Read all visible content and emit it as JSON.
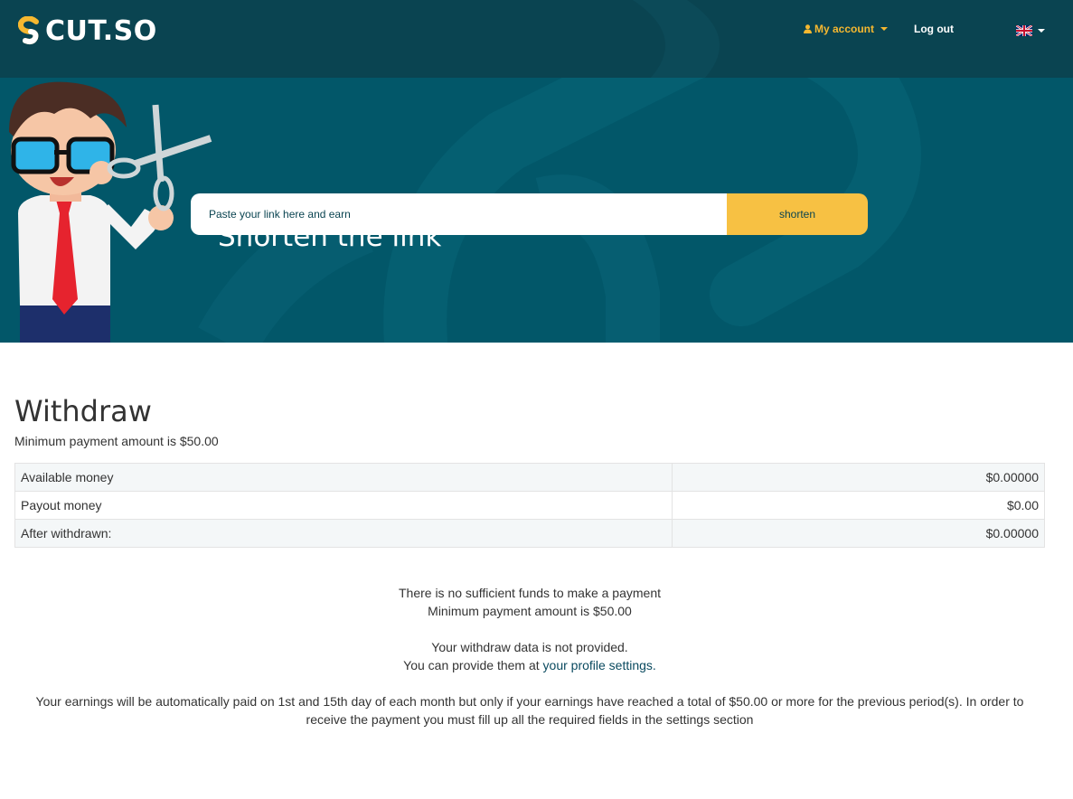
{
  "brand": {
    "name": "CUT.SO"
  },
  "nav": {
    "account_label": "My account",
    "logout_label": "Log out",
    "language": "EN"
  },
  "hero": {
    "title": "Shorten the link",
    "input_placeholder": "Paste your link here and earn",
    "button_label": "shorten"
  },
  "withdraw": {
    "title": "Withdraw",
    "min_note": "Minimum payment amount is $50.00",
    "rows": [
      {
        "label": "Available money",
        "value": "$0.00000"
      },
      {
        "label": "Payout money",
        "value": "$0.00"
      },
      {
        "label": "After withdrawn:",
        "value": "$0.00000"
      }
    ],
    "insufficient_line1": "There is no sufficient funds to make a payment",
    "insufficient_line2": "Minimum payment amount is $50.00",
    "data_line1": "Your withdraw data is not provided.",
    "data_line2_prefix": "You can provide them at",
    "profile_link": "your profile settings.",
    "auto_pay_note": "Your earnings will be automatically paid on 1st and 15th day of each month but only if your earnings have reached a total of $50.00 or more for the previous period(s). In order to receive the payment you must fill up all the required fields in the settings section"
  },
  "colors": {
    "header_bg": "#0a4451",
    "hero_bg": "#025769",
    "accent": "#f7c143",
    "link": "#0a4a5f"
  }
}
